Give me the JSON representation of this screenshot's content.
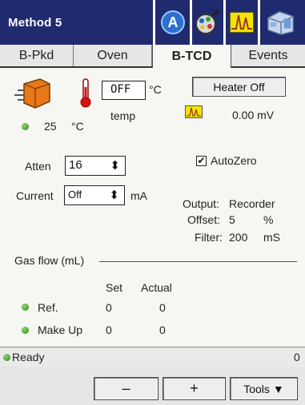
{
  "window": {
    "title": "Method 5"
  },
  "toolbar_icons": [
    "a-circle-icon",
    "gear-icon",
    "signal-peak-icon",
    "instrument-icon"
  ],
  "tabs": [
    {
      "label": "B-Pkd",
      "active": false
    },
    {
      "label": "Oven",
      "active": false
    },
    {
      "label": "B-TCD",
      "active": true
    },
    {
      "label": "Events",
      "active": false
    }
  ],
  "detector": {
    "temp_value": "OFF",
    "temp_unit": "°C",
    "temp_label": "temp",
    "actual_temp": "25",
    "actual_temp_unit": "°C",
    "heater_button": "Heater Off",
    "signal_value": "0.00 mV"
  },
  "atten": {
    "label": "Atten",
    "value": "16"
  },
  "current": {
    "label": "Current",
    "value": "Off",
    "unit": "mA"
  },
  "autozero": {
    "label": "AutoZero",
    "checked": true,
    "mark": "✔"
  },
  "output": {
    "output_label": "Output:",
    "output_value": "Recorder",
    "offset_label": "Offset:",
    "offset_value": "5",
    "offset_unit": "%",
    "filter_label": "Filter:",
    "filter_value": "200",
    "filter_unit": "mS"
  },
  "gas_flow": {
    "heading": "Gas flow (mL)",
    "col_set": "Set",
    "col_actual": "Actual",
    "rows": [
      {
        "name": "Ref.",
        "set": "0",
        "actual": "0"
      },
      {
        "name": "Make Up",
        "set": "0",
        "actual": "0"
      }
    ]
  },
  "status": {
    "text": "Ready",
    "count": "0"
  },
  "bottom": {
    "minus": "–",
    "plus": "+",
    "tools": "Tools"
  },
  "colors": {
    "titlebar": "#202a6e",
    "led": "#3aa52a",
    "signal": "#f4e400"
  }
}
